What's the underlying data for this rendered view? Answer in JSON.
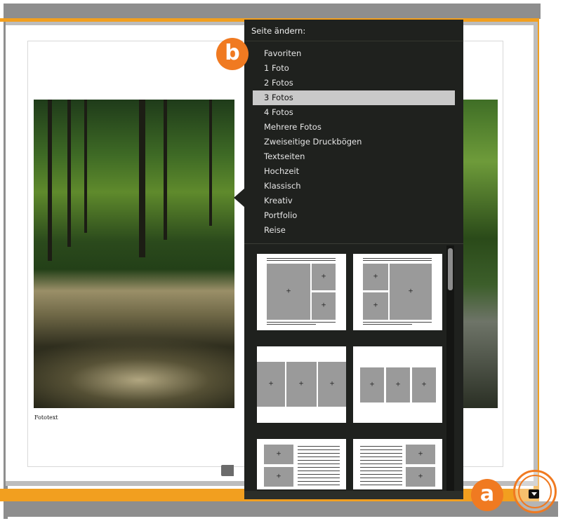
{
  "spread": {
    "caption": "Fototext"
  },
  "popover": {
    "title": "Seite ändern:",
    "selected_index": 3,
    "items": [
      {
        "label": "Favoriten"
      },
      {
        "label": "1 Foto"
      },
      {
        "label": "2 Fotos"
      },
      {
        "label": "3 Fotos"
      },
      {
        "label": "4 Fotos"
      },
      {
        "label": "Mehrere Fotos"
      },
      {
        "label": "Zweiseitige Druckbögen"
      },
      {
        "label": "Textseiten"
      },
      {
        "label": "Hochzeit"
      },
      {
        "label": "Klassisch"
      },
      {
        "label": "Kreativ"
      },
      {
        "label": "Portfolio"
      },
      {
        "label": "Reise"
      }
    ],
    "thumb_plus": "+"
  },
  "callouts": {
    "a": "a",
    "b": "b"
  },
  "colors": {
    "accent_orange": "#f07a21",
    "frame_orange": "#f29f1f",
    "popover_bg": "#1f211e",
    "selected_bg": "#c9c9c9"
  },
  "icons": {
    "page_menu_button": "caret-down-icon"
  }
}
